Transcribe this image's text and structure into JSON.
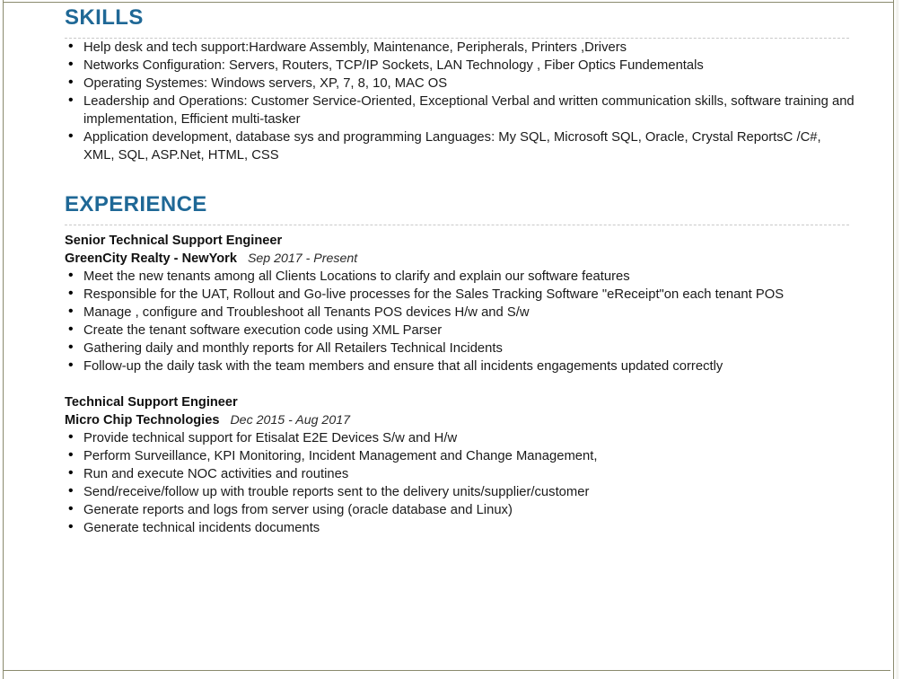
{
  "document": {
    "type": "resume",
    "heading_color": "#1f6896",
    "body_text_color": "#1a1a1a",
    "border_color": "#8a8a6e"
  },
  "sections": {
    "skills": {
      "title": "SKILLS",
      "items": [
        "Help desk and tech support:Hardware Assembly, Maintenance, Peripherals, Printers ,Drivers",
        "Networks Configuration: Servers, Routers, TCP/IP Sockets, LAN Technology , Fiber Optics Fundementals",
        "Operating Systemes: Windows servers, XP, 7, 8, 10, MAC OS",
        "Leadership and Operations: Customer Service-Oriented, Exceptional Verbal and written communication skills, software training and implementation, Efficient multi-tasker",
        "Application development, database sys and programming Languages: My SQL, Microsoft SQL, Oracle, Crystal ReportsC /C#, XML, SQL, ASP.Net, HTML, CSS"
      ]
    },
    "experience": {
      "title": "EXPERIENCE",
      "jobs": [
        {
          "title": "Senior Technical Support Engineer",
          "company": "GreenCity Realty - NewYork",
          "dates": "Sep 2017 - Present",
          "bullets": [
            "Meet the new tenants among all Clients Locations to clarify and explain our software features",
            "Responsible for the UAT, Rollout and Go-live processes for the Sales Tracking Software \"eReceipt\"on each tenant POS",
            "Manage , configure and Troubleshoot all Tenants POS devices H/w and S/w",
            "Create the tenant software execution code using XML Parser",
            "Gathering daily and monthly reports for All Retailers Technical Incidents",
            "Follow-up the daily task with the team members and ensure that all incidents engagements updated correctly"
          ]
        },
        {
          "title": "Technical Support Engineer",
          "company": "Micro Chip Technologies",
          "dates": "Dec 2015 - Aug 2017",
          "bullets": [
            "Provide technical support for Etisalat E2E Devices S/w and H/w",
            "Perform Surveillance, KPI Monitoring, Incident Management and Change Management,",
            "Run and execute NOC activities and routines",
            "Send/receive/follow up with trouble reports sent to the delivery units/supplier/customer",
            "Generate reports and logs from server using (oracle database and Linux)",
            "Generate technical  incidents documents"
          ]
        }
      ]
    }
  }
}
